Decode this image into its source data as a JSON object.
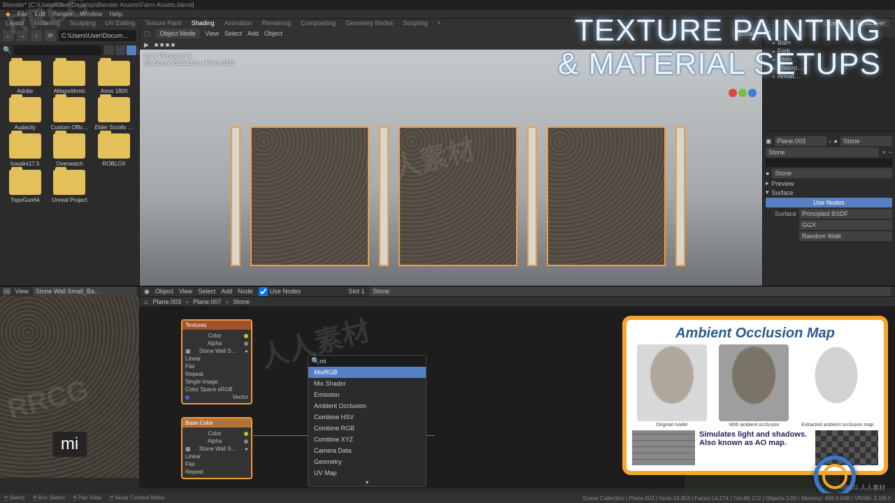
{
  "window": {
    "title": "Blender* [C:\\Users\\User\\Desktop\\Blender Assets\\Farm Assets.blend]"
  },
  "menubar": [
    "File",
    "Edit",
    "Render",
    "Window",
    "Help"
  ],
  "workspaces": [
    "Layout",
    "Modeling",
    "Sculpting",
    "UV Editing",
    "Texture Paint",
    "Shading",
    "Animation",
    "Rendering",
    "Compositing",
    "Geometry Nodes",
    "Scripting",
    "+"
  ],
  "workspace_active": "Shading",
  "scene": {
    "scene_name": "Scene",
    "viewlayer": "ViewLayer"
  },
  "filebrowser": {
    "path": "C:\\Users\\User\\Docum…",
    "view_menu": "View",
    "folders": [
      "Adobe",
      "Allegorithmic",
      "Anno 1800",
      "Audacity",
      "Custom Offic…",
      "Elder Scrolls …",
      "houdini17.5",
      "Overwatch",
      "ROBLOX",
      "TopoGun64",
      "Unreal Project"
    ]
  },
  "viewport": {
    "mode": "Object Mode",
    "menus": [
      "View",
      "Select",
      "Add",
      "Object"
    ],
    "shading_pivot": "Global",
    "hint_line1": "User Perspective",
    "hint_line2": "(0) Scene Collection | Plane.003"
  },
  "overlay": {
    "line1": "TEXTURE PAINTING",
    "line2": "& MATERIAL SETUPS"
  },
  "outliner": {
    "items": [
      "Barn",
      "Fork",
      "Lodg…",
      "Waterp…",
      "Armat…"
    ]
  },
  "properties": {
    "datablock_obj": "Plane.003",
    "datablock_mat": "Stone",
    "mat_slot": "Stone",
    "preview": "Preview",
    "surface": "Surface",
    "use_nodes": "Use Nodes",
    "surface_label": "Surface",
    "surface_value": "Principled BSDF",
    "distribution": "GGX",
    "subsurf": "Random Walk"
  },
  "image_editor": {
    "menus": [
      "View"
    ],
    "image": "Stone Wall Small_Ba…",
    "typed": "mi"
  },
  "node_editor": {
    "object_menu": "Object",
    "menus": [
      "View",
      "Select",
      "Add",
      "Node"
    ],
    "use_nodes_label": "Use Nodes",
    "use_nodes": true,
    "slot": "Slot 1",
    "material": "Stone",
    "breadcrumb": [
      "Plane.003",
      "Plane.007",
      "Stone"
    ],
    "node_tex": {
      "title": "Textures",
      "rows_right": [
        "Color",
        "Alpha"
      ],
      "image": "Stone Wall S…",
      "props": [
        "Linear",
        "Flat",
        "Repeat",
        "Single Image"
      ],
      "colorspace": "Color Space    sRGB",
      "vector": "Vector"
    },
    "node_base": {
      "title": "Base Color",
      "rows_right": [
        "Color",
        "Alpha"
      ],
      "image": "Stone Wall S…",
      "props": [
        "Linear",
        "Flat",
        "Repeat"
      ]
    },
    "search": {
      "query": "mi",
      "results": [
        "MixRGB",
        "Mix Shader",
        "Emission",
        "Ambient Occlusion",
        "Combine HSV",
        "Combine RGB",
        "Combine XYZ",
        "Camera Data",
        "Geometry",
        "UV Map"
      ],
      "highlight": 0
    }
  },
  "ao_card": {
    "title": "Ambient Occlusion Map",
    "captions": [
      "Original model",
      "With ambient occlusion",
      "Extracted ambient occlusion map"
    ],
    "body": "Simulates light and shadows. Also known as AO map."
  },
  "statusbar": {
    "left": [
      "Select",
      "Box Select",
      "Pan View",
      "Node Context Menu"
    ],
    "right": "Scene Collection | Plane.003 | Verts:43,953 | Faces:14,274 | Tris:86,172 | Objects:1/20 | Memory: 496.4 MiB | VRAM: 3.0/8.0"
  },
  "watermarks": [
    "RRCG",
    "人人素材",
    "人人素材",
    "RRCG",
    "RRCG 人人素材"
  ]
}
